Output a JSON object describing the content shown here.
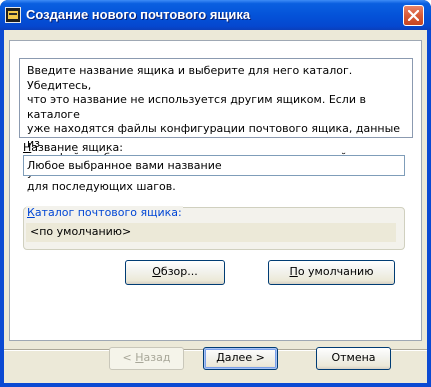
{
  "window": {
    "title": "Создание нового почтового ящика",
    "close_icon": "close-icon"
  },
  "info": {
    "text": "Введите название ящика и выберите для него каталог. Убедитесь,\nчто это название не используется другим ящиком. Если в каталоге\nуже находятся файлы конфигурации почтового ящика, данные из\nэтих файлов будут использованы в качестве значений по умолчанию\nдля последующих шагов."
  },
  "mailbox_name": {
    "label_mnemonic": "Н",
    "label_rest": "азвание ящика:",
    "value": "Любое выбранное вами название"
  },
  "directory": {
    "legend_mnemonic": "К",
    "legend_rest": "аталог почтового ящика:",
    "value": "<по умолчанию>"
  },
  "buttons": {
    "browse_mnemonic": "О",
    "browse_rest": "бзор...",
    "default_mnemonic": "П",
    "default_rest": "о умолчанию",
    "back_prefix": "< ",
    "back_mnemonic": "Н",
    "back_rest": "азад",
    "next_mnemonic": "Д",
    "next_rest": "алее >",
    "cancel": "Отмена"
  },
  "colors": {
    "titlebar": "#0453d9",
    "dialog_bg": "#ece9d8",
    "legend": "#0046d5"
  }
}
